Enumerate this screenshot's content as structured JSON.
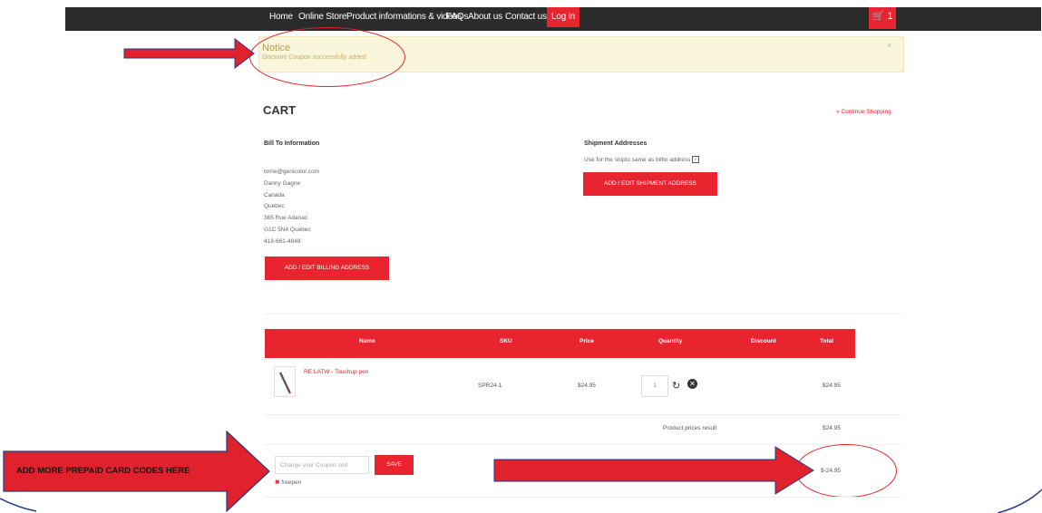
{
  "nav": {
    "items": [
      "Home",
      "Online Store",
      "Product informations & videos",
      "FAQs",
      "About us",
      "Contact us"
    ],
    "login": "Log in",
    "cart_count": "1"
  },
  "notice": {
    "title": "Notice",
    "message": "Discount Coupon successfully added",
    "close": "×"
  },
  "cart": {
    "title": "CART",
    "continue_link": "« Continue Shopping"
  },
  "bill_to": {
    "label": "Bill To Information",
    "lines": [
      "tome@genicolor.com",
      "Danny Gagne",
      "Canada",
      "Quebec",
      "365 Rue Adanac",
      "G1C 5N4 Quebec",
      "418-661-4848"
    ],
    "button": "ADD / EDIT BILLING ADDRESS"
  },
  "shipment": {
    "label": "Shipment Addresses",
    "same_as_billing": "Use for the shipto same as billto address",
    "button": "ADD / EDIT SHIPMENT ADDRESS"
  },
  "table": {
    "headers": [
      "Name",
      "SKU",
      "Price",
      "Quantity",
      "Discount",
      "Total"
    ],
    "rows": [
      {
        "name": "RE:LATW - Touchup pen",
        "sku": "SPR24-1",
        "price": "$24.95",
        "quantity": "1",
        "discount": "",
        "total": "$24.95"
      }
    ],
    "subtotal_label": "Product prices result",
    "subtotal_value": "$24.95",
    "discount_value": "$-24.95"
  },
  "coupon": {
    "placeholder": "Change your Coupon cod",
    "save": "SAVE",
    "applied": "freepen"
  },
  "annotation": {
    "arrow_label": "ADD MORE PREPAID CARD CODES HERE"
  },
  "colors": {
    "brand_red": "#e8242f",
    "nav_dark": "#2b2b2b",
    "notice_bg": "#faf6dc"
  }
}
